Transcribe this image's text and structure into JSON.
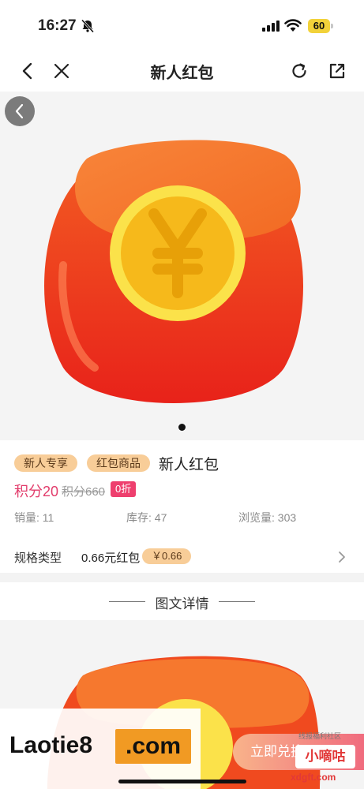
{
  "status_bar": {
    "time": "16:27",
    "battery": "60"
  },
  "nav": {
    "title": "新人红包"
  },
  "product": {
    "tags": [
      "新人专享",
      "红包商品"
    ],
    "name": "新人红包",
    "price": "积分20",
    "original_price": "积分660",
    "discount": "0折",
    "stats": {
      "sales": "销量: 11",
      "stock": "库存: 47",
      "views": "浏览量: 303"
    },
    "spec_label": "规格类型",
    "spec_value": "0.66元红包",
    "spec_price": "￥0.66"
  },
  "detail": {
    "title": "图文详情"
  },
  "actions": {
    "buy_label": "立即兑换"
  },
  "watermarks": {
    "site_text": "Laotie8",
    "site_dotcom": ".com",
    "badge": "小嘀咕",
    "badge_sub": "线报福利社区",
    "badge_url": "xdgft.com"
  },
  "colors": {
    "accent": "#e23c6b",
    "tag_bg": "#f8cd98",
    "envelope": "#f0521f",
    "coin": "#f6c21c"
  }
}
